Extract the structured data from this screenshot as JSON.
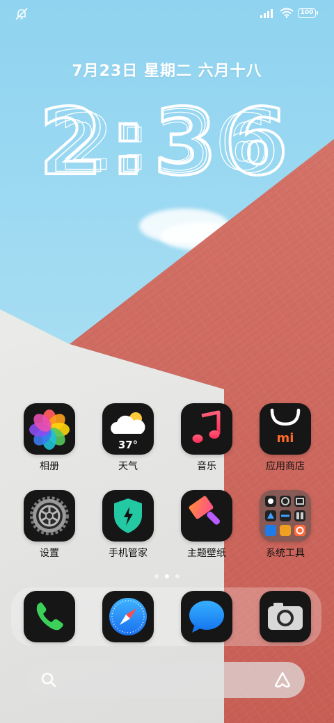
{
  "status_bar": {
    "left_icon": "no-notifications-icon",
    "signal_icon": "signal-bars-icon",
    "wifi_icon": "wifi-icon",
    "battery": "100"
  },
  "lockscreen": {
    "date": "7月23日 星期二 六月十八",
    "time": "2:36"
  },
  "apps": [
    {
      "label": "相册",
      "icon": "photos-icon"
    },
    {
      "label": "天气",
      "icon": "weather-icon",
      "temperature": "37°"
    },
    {
      "label": "音乐",
      "icon": "music-icon"
    },
    {
      "label": "应用商店",
      "icon": "app-store-icon",
      "badge": "mi"
    },
    {
      "label": "设置",
      "icon": "settings-gear-icon"
    },
    {
      "label": "手机管家",
      "icon": "security-shield-icon"
    },
    {
      "label": "主题壁纸",
      "icon": "theme-brush-icon"
    },
    {
      "label": "系统工具",
      "icon": "folder-icon"
    }
  ],
  "page_indicator": {
    "count": 3,
    "active": 2
  },
  "dock": [
    {
      "icon": "phone-icon"
    },
    {
      "icon": "browser-compass-icon"
    },
    {
      "icon": "messages-icon"
    },
    {
      "icon": "camera-icon"
    }
  ],
  "search": {
    "placeholder": "",
    "left_icon": "search-icon",
    "right_icon": "assistant-icon"
  },
  "colors": {
    "sky": "#8fd3f0",
    "brick": "#cf6b61",
    "wall": "#eaeae8",
    "icon_background": "#161616"
  }
}
